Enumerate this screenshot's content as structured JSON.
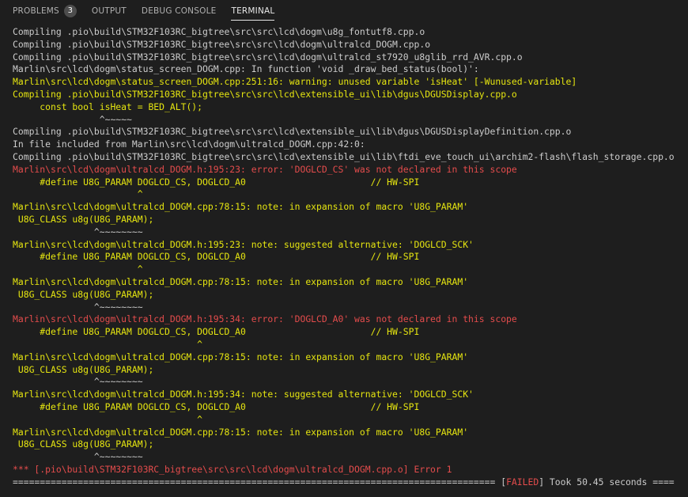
{
  "tabs": [
    {
      "label": "PROBLEMS",
      "badge": "3"
    },
    {
      "label": "OUTPUT"
    },
    {
      "label": "DEBUG CONSOLE"
    },
    {
      "label": "TERMINAL"
    }
  ],
  "colors": {
    "background": "#1e1e1e",
    "default_text": "#cccccc",
    "yellow": "#e5e510",
    "red": "#e44c4c"
  },
  "terminal": {
    "lines": [
      {
        "text": "Compiling .pio\\build\\STM32F103RC_bigtree\\src\\src\\lcd\\dogm\\u8g_fontutf8.cpp.o",
        "color": "white"
      },
      {
        "text": "Compiling .pio\\build\\STM32F103RC_bigtree\\src\\src\\lcd\\dogm\\ultralcd_DOGM.cpp.o",
        "color": "white"
      },
      {
        "text": "Compiling .pio\\build\\STM32F103RC_bigtree\\src\\src\\lcd\\dogm\\ultralcd_st7920_u8glib_rrd_AVR.cpp.o",
        "color": "white"
      },
      {
        "text": "Marlin\\src\\lcd\\dogm\\status_screen_DOGM.cpp: In function 'void _draw_bed_status(bool)':",
        "color": "white"
      },
      {
        "text": "Marlin\\src\\lcd\\dogm\\status_screen_DOGM.cpp:251:16: warning: unused variable 'isHeat' [-Wunused-variable]",
        "color": "yellow"
      },
      {
        "text": "Compiling .pio\\build\\STM32F103RC_bigtree\\src\\src\\lcd\\extensible_ui\\lib\\dgus\\DGUSDisplay.cpp.o",
        "color": "yellow"
      },
      {
        "text": "     const bool isHeat = BED_ALT();",
        "color": "yellow"
      },
      {
        "text": "                ^~~~~~",
        "color": "grey"
      },
      {
        "text": "Compiling .pio\\build\\STM32F103RC_bigtree\\src\\src\\lcd\\extensible_ui\\lib\\dgus\\DGUSDisplayDefinition.cpp.o",
        "color": "white"
      },
      {
        "text": "In file included from Marlin\\src\\lcd\\dogm\\ultralcd_DOGM.cpp:42:0:",
        "color": "white"
      },
      {
        "text": "Compiling .pio\\build\\STM32F103RC_bigtree\\src\\src\\lcd\\extensible_ui\\lib\\ftdi_eve_touch_ui\\archim2-flash\\flash_storage.cpp.o",
        "color": "white"
      },
      {
        "text": "Marlin\\src\\lcd\\dogm\\ultralcd_DOGM.h:195:23: error: 'DOGLCD_CS' was not declared in this scope",
        "color": "red"
      },
      {
        "text": "     #define U8G_PARAM DOGLCD_CS, DOGLCD_A0                       // HW-SPI",
        "color": "yellow"
      },
      {
        "text": "                       ^",
        "color": "yellow"
      },
      {
        "text": "Marlin\\src\\lcd\\dogm\\ultralcd_DOGM.cpp:78:15: note: in expansion of macro 'U8G_PARAM'",
        "color": "yellow"
      },
      {
        "text": " U8G_CLASS u8g(U8G_PARAM);",
        "color": "yellow"
      },
      {
        "text": "               ^~~~~~~~~",
        "color": "grey"
      },
      {
        "text": "Marlin\\src\\lcd\\dogm\\ultralcd_DOGM.h:195:23: note: suggested alternative: 'DOGLCD_SCK'",
        "color": "yellow"
      },
      {
        "text": "     #define U8G_PARAM DOGLCD_CS, DOGLCD_A0                       // HW-SPI",
        "color": "yellow"
      },
      {
        "text": "                       ^",
        "color": "yellow"
      },
      {
        "text": "Marlin\\src\\lcd\\dogm\\ultralcd_DOGM.cpp:78:15: note: in expansion of macro 'U8G_PARAM'",
        "color": "yellow"
      },
      {
        "text": " U8G_CLASS u8g(U8G_PARAM);",
        "color": "yellow"
      },
      {
        "text": "               ^~~~~~~~~",
        "color": "grey"
      },
      {
        "text": "Marlin\\src\\lcd\\dogm\\ultralcd_DOGM.h:195:34: error: 'DOGLCD_A0' was not declared in this scope",
        "color": "red"
      },
      {
        "text": "     #define U8G_PARAM DOGLCD_CS, DOGLCD_A0                       // HW-SPI",
        "color": "yellow"
      },
      {
        "text": "                                  ^",
        "color": "yellow"
      },
      {
        "text": "Marlin\\src\\lcd\\dogm\\ultralcd_DOGM.cpp:78:15: note: in expansion of macro 'U8G_PARAM'",
        "color": "yellow"
      },
      {
        "text": " U8G_CLASS u8g(U8G_PARAM);",
        "color": "yellow"
      },
      {
        "text": "               ^~~~~~~~~",
        "color": "grey"
      },
      {
        "text": "Marlin\\src\\lcd\\dogm\\ultralcd_DOGM.h:195:34: note: suggested alternative: 'DOGLCD_SCK'",
        "color": "yellow"
      },
      {
        "text": "     #define U8G_PARAM DOGLCD_CS, DOGLCD_A0                       // HW-SPI",
        "color": "yellow"
      },
      {
        "text": "                                  ^",
        "color": "yellow"
      },
      {
        "text": "Marlin\\src\\lcd\\dogm\\ultralcd_DOGM.cpp:78:15: note: in expansion of macro 'U8G_PARAM'",
        "color": "yellow"
      },
      {
        "text": " U8G_CLASS u8g(U8G_PARAM);",
        "color": "yellow"
      },
      {
        "text": "               ^~~~~~~~~",
        "color": "grey"
      },
      {
        "text": "*** [.pio\\build\\STM32F103RC_bigtree\\src\\src\\lcd\\dogm\\ultralcd_DOGM.cpp.o] Error 1",
        "color": "red"
      }
    ],
    "status_line": {
      "prefix": "========================================================================================= [",
      "failed": "FAILED",
      "suffix": "] Took 50.45 seconds ===="
    }
  }
}
